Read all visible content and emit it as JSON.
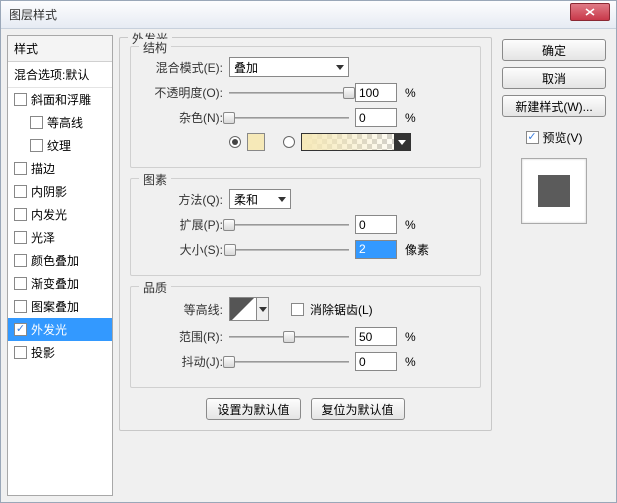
{
  "title": "图层样式",
  "left": {
    "header": "样式",
    "blend": "混合选项:默认",
    "items": [
      {
        "label": "斜面和浮雕",
        "checked": false,
        "indent": false,
        "selected": false
      },
      {
        "label": "等高线",
        "checked": false,
        "indent": true,
        "selected": false
      },
      {
        "label": "纹理",
        "checked": false,
        "indent": true,
        "selected": false
      },
      {
        "label": "描边",
        "checked": false,
        "indent": false,
        "selected": false
      },
      {
        "label": "内阴影",
        "checked": false,
        "indent": false,
        "selected": false
      },
      {
        "label": "内发光",
        "checked": false,
        "indent": false,
        "selected": false
      },
      {
        "label": "光泽",
        "checked": false,
        "indent": false,
        "selected": false
      },
      {
        "label": "颜色叠加",
        "checked": false,
        "indent": false,
        "selected": false
      },
      {
        "label": "渐变叠加",
        "checked": false,
        "indent": false,
        "selected": false
      },
      {
        "label": "图案叠加",
        "checked": false,
        "indent": false,
        "selected": false
      },
      {
        "label": "外发光",
        "checked": true,
        "indent": false,
        "selected": true
      },
      {
        "label": "投影",
        "checked": false,
        "indent": false,
        "selected": false
      }
    ]
  },
  "mid": {
    "outer_legend": "外发光",
    "structure": {
      "legend": "结构",
      "blend_mode_label": "混合模式(E):",
      "blend_mode_value": "叠加",
      "opacity_label": "不透明度(O):",
      "opacity_value": "100",
      "opacity_unit": "%",
      "noise_label": "杂色(N):",
      "noise_value": "0",
      "noise_unit": "%",
      "color_swatch": "#f6e9b8"
    },
    "elements": {
      "legend": "图素",
      "technique_label": "方法(Q):",
      "technique_value": "柔和",
      "spread_label": "扩展(P):",
      "spread_value": "0",
      "spread_unit": "%",
      "size_label": "大小(S):",
      "size_value": "2",
      "size_unit": "像素"
    },
    "quality": {
      "legend": "品质",
      "contour_label": "等高线:",
      "antialias_label": "消除锯齿(L)",
      "range_label": "范围(R):",
      "range_value": "50",
      "range_unit": "%",
      "jitter_label": "抖动(J):",
      "jitter_value": "0",
      "jitter_unit": "%"
    },
    "buttons": {
      "default": "设置为默认值",
      "reset": "复位为默认值"
    }
  },
  "right": {
    "ok": "确定",
    "cancel": "取消",
    "new_style": "新建样式(W)...",
    "preview_label": "预览(V)"
  }
}
